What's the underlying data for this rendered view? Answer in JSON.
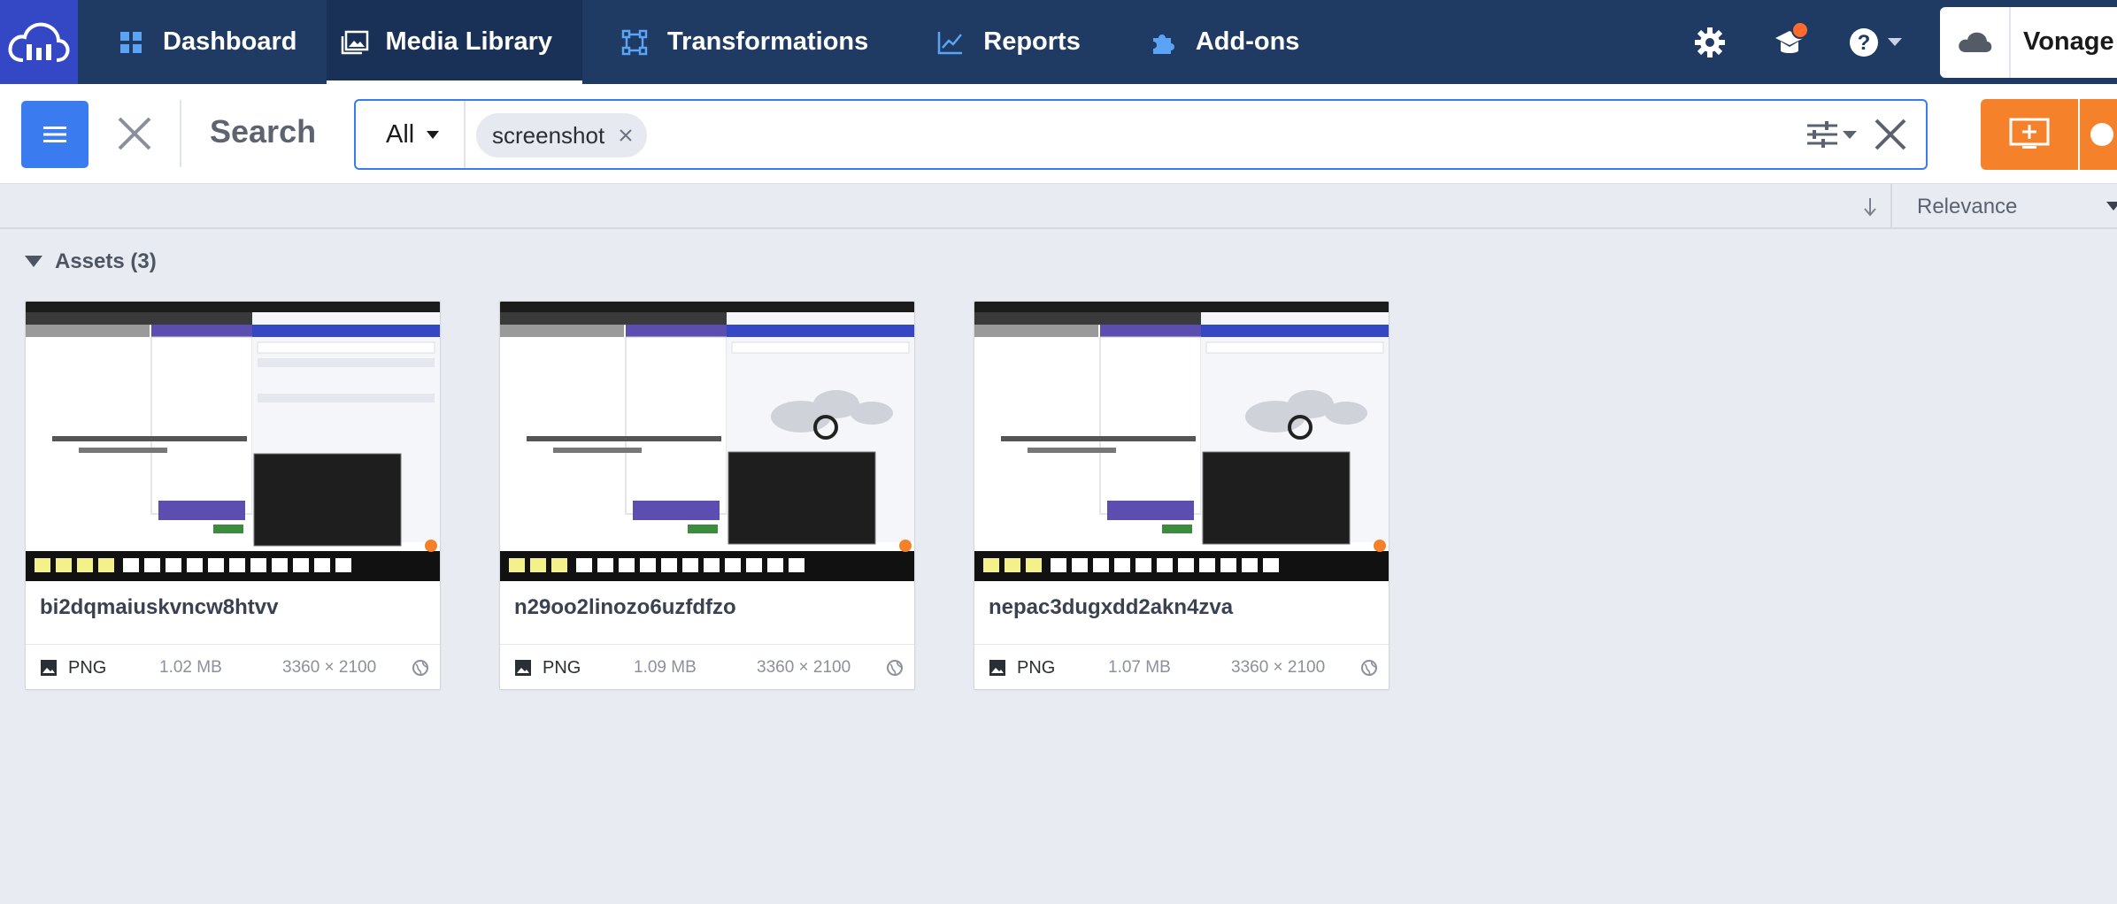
{
  "nav": {
    "items": [
      {
        "label": "Dashboard",
        "icon": "grid-icon"
      },
      {
        "label": "Media Library",
        "icon": "images-icon"
      },
      {
        "label": "Transformations",
        "icon": "transform-icon"
      },
      {
        "label": "Reports",
        "icon": "chart-icon"
      },
      {
        "label": "Add-ons",
        "icon": "puzzle-icon"
      }
    ],
    "account_name": "Vonage"
  },
  "search": {
    "title": "Search",
    "scope": "All",
    "chip": "screenshot"
  },
  "sort": {
    "label": "Relevance"
  },
  "section": {
    "label": "Assets (3)"
  },
  "assets": [
    {
      "name": "bi2dqmaiuskvncw8htvv",
      "type": "PNG",
      "size": "1.02 MB",
      "dimensions": "3360 × 2100"
    },
    {
      "name": "n29oo2linozo6uzfdfzo",
      "type": "PNG",
      "size": "1.09 MB",
      "dimensions": "3360 × 2100"
    },
    {
      "name": "nepac3dugxdd2akn4zva",
      "type": "PNG",
      "size": "1.07 MB",
      "dimensions": "3360 × 2100"
    }
  ],
  "colors": {
    "nav_bg": "#1f3a63",
    "logo_bg": "#3448c5",
    "accent_blue": "#3a7bf0",
    "upload_orange": "#f5812a",
    "page_bg": "#e8ecf2"
  }
}
